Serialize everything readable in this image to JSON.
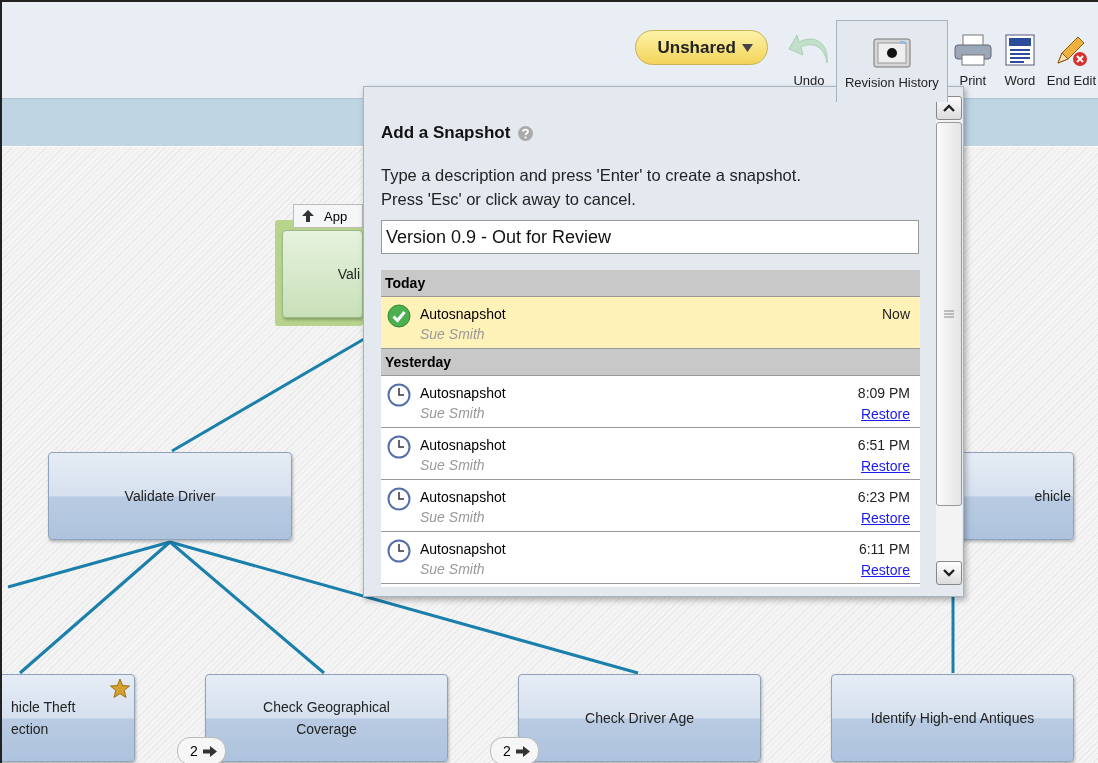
{
  "toolbar": {
    "share_button": {
      "label": "Unshared"
    },
    "buttons": [
      {
        "label": "Undo",
        "kind": "undo",
        "disabled": true,
        "selected": false
      },
      {
        "label": "Revision History",
        "kind": "camera",
        "disabled": false,
        "selected": true
      },
      {
        "label": "Print",
        "kind": "print",
        "disabled": false,
        "selected": false
      },
      {
        "label": "Word",
        "kind": "word",
        "disabled": false,
        "selected": false
      },
      {
        "label": "End Edit",
        "kind": "end-edit",
        "disabled": false,
        "selected": false
      }
    ]
  },
  "canvas": {
    "nodes": [
      {
        "lines": [
          "Vali"
        ],
        "approved": true,
        "tab": "App"
      },
      {
        "lines": [
          "Validate Driver"
        ],
        "approved": false
      },
      {
        "lines": [
          "ehicle"
        ],
        "approved": false
      },
      {
        "lines": [
          "hicle Theft",
          "ection"
        ],
        "approved": false,
        "starred": true
      },
      {
        "lines": [
          "Check Geographical",
          "Coverage"
        ],
        "approved": false,
        "badge": "2"
      },
      {
        "lines": [
          "Check Driver Age"
        ],
        "approved": false,
        "badge": "2"
      },
      {
        "lines": [
          "Identify High-end Antiques"
        ],
        "approved": false
      }
    ]
  },
  "snapshot_popup": {
    "title": "Add a Snapshot",
    "instructions": [
      "Type a description and press 'Enter' to create a snapshot.",
      "Press 'Esc' or click away to cancel."
    ],
    "input_value": "Version 0.9 - Out for Review",
    "groups": [
      {
        "label": "Today",
        "items": [
          {
            "name": "Autosnapshot",
            "author": "Sue Smith",
            "time": "Now",
            "current": true
          }
        ]
      },
      {
        "label": "Yesterday",
        "items": [
          {
            "name": "Autosnapshot",
            "author": "Sue Smith",
            "time": "8:09 PM",
            "current": false,
            "restore": "Restore"
          },
          {
            "name": "Autosnapshot",
            "author": "Sue Smith",
            "time": "6:51 PM",
            "current": false,
            "restore": "Restore"
          },
          {
            "name": "Autosnapshot",
            "author": "Sue Smith",
            "time": "6:23 PM",
            "current": false,
            "restore": "Restore"
          },
          {
            "name": "Autosnapshot",
            "author": "Sue Smith",
            "time": "6:11 PM",
            "current": false,
            "restore": "Restore"
          }
        ]
      }
    ]
  }
}
